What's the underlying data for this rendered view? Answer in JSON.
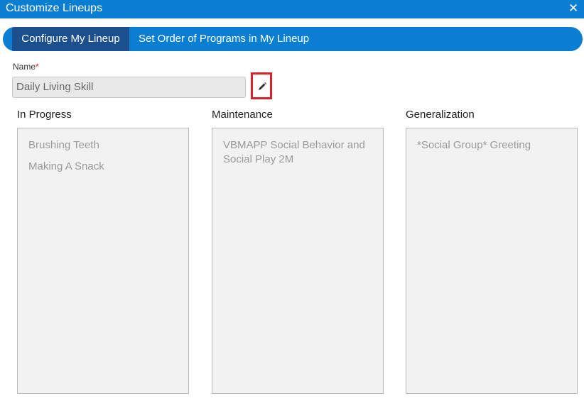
{
  "window": {
    "title": "Customize Lineups",
    "close_label": "✕"
  },
  "tabs": [
    {
      "label": "Configure My Lineup"
    },
    {
      "label": "Set Order of Programs in My Lineup"
    }
  ],
  "name_field": {
    "label": "Name",
    "required_marker": "*",
    "value": "Daily Living Skill"
  },
  "columns": [
    {
      "title": "In Progress",
      "items": [
        "Brushing Teeth",
        "Making A Snack"
      ]
    },
    {
      "title": "Maintenance",
      "items": [
        "VBMAPP Social Behavior and Social Play 2M"
      ]
    },
    {
      "title": "Generalization",
      "items": [
        "*Social Group* Greeting"
      ]
    }
  ],
  "colors": {
    "accent": "#0a7fd1",
    "active_tab": "#1c4f8e",
    "highlight": "#d9232a"
  },
  "icons": {
    "edit": "pencil-icon",
    "close": "close-icon"
  }
}
